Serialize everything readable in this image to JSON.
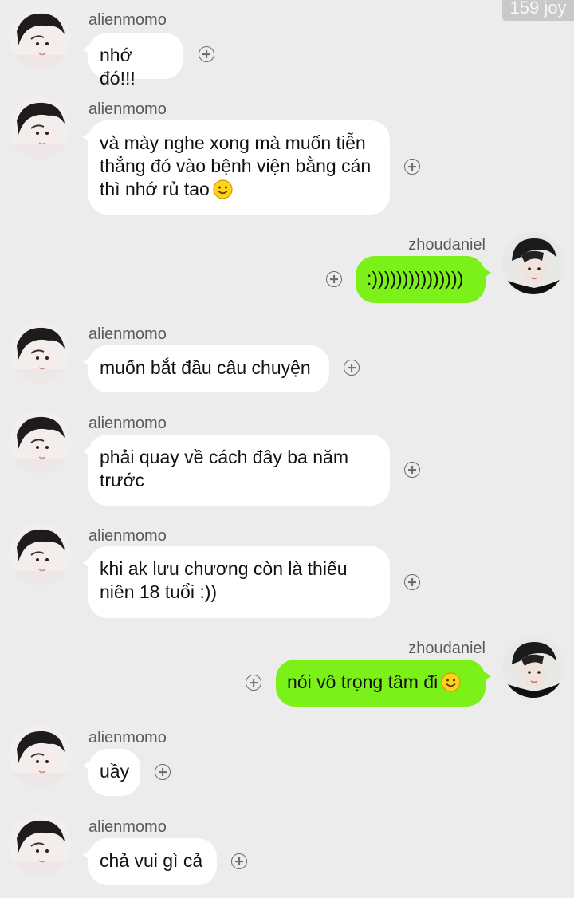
{
  "watermark": "159 joy",
  "users": {
    "left": "alienmomo",
    "right": "zhoudaniel"
  },
  "messages": [
    {
      "side": "left",
      "name": "alienmomo",
      "text": "nhớ đó!!!",
      "emoji": false
    },
    {
      "side": "left",
      "name": "alienmomo",
      "lines": [
        "và mày nghe xong mà muốn tiễn",
        "thẳng đó vào bệnh viện bằng cán",
        "thì nhớ rủ tao"
      ],
      "emoji": true
    },
    {
      "side": "right",
      "name": "zhoudaniel",
      "text": ":)))))))))))))))",
      "emoji": false
    },
    {
      "side": "left",
      "name": "alienmomo",
      "text": "muốn bắt đầu câu chuyện",
      "emoji": false
    },
    {
      "side": "left",
      "name": "alienmomo",
      "lines": [
        "phải quay về cách đây ba năm",
        "trước"
      ],
      "emoji": false
    },
    {
      "side": "left",
      "name": "alienmomo",
      "lines": [
        "khi ak lưu chương còn là thiếu",
        "niên 18 tuổi :))"
      ],
      "emoji": false
    },
    {
      "side": "right",
      "name": "zhoudaniel",
      "text": "nói vô trọng tâm đi",
      "emoji": true
    },
    {
      "side": "left",
      "name": "alienmomo",
      "text": "uầy",
      "emoji": false
    },
    {
      "side": "left",
      "name": "alienmomo",
      "text": "chả vui gì cả",
      "emoji": false
    }
  ],
  "icons": {
    "add_reaction": "plus-circle-icon",
    "emoji": "smiley-face-icon"
  },
  "colors": {
    "background": "#ececec",
    "incoming_bubble": "#ffffff",
    "outgoing_bubble": "#7cf119",
    "name_text": "#5a5a5a"
  }
}
